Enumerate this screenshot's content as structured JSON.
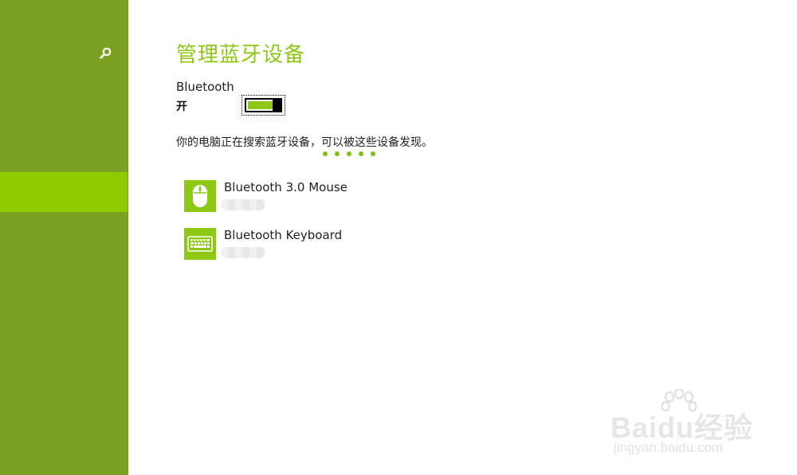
{
  "sidebar": {
    "search_icon": "search-icon",
    "selected_item": ""
  },
  "main": {
    "title": "管理蓝牙设备",
    "bluetooth_label": "Bluetooth",
    "bluetooth_state": "开",
    "toggle_on": true,
    "status_text": "你的电脑正在搜索蓝牙设备，可以被这些设备发现。",
    "devices": [
      {
        "name": "Bluetooth 3.0 Mouse",
        "icon": "mouse-icon"
      },
      {
        "name": "Bluetooth Keyboard",
        "icon": "keyboard-icon"
      }
    ]
  },
  "watermark": {
    "text": "Baidu经验",
    "url": "jingyan.baidu.com"
  },
  "colors": {
    "sidebar": "#7ba022",
    "sidebar_selected": "#8fcc00",
    "accent": "#8cc814"
  }
}
